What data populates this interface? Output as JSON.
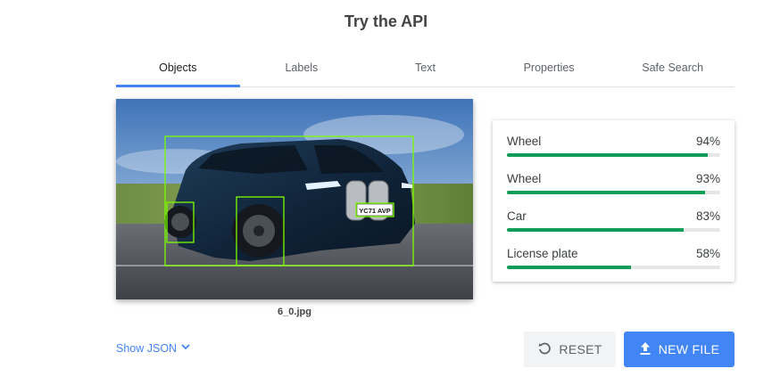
{
  "page": {
    "title": "Try the API"
  },
  "tabs": [
    {
      "label": "Objects",
      "active": true
    },
    {
      "label": "Labels",
      "active": false
    },
    {
      "label": "Text",
      "active": false
    },
    {
      "label": "Properties",
      "active": false
    },
    {
      "label": "Safe Search",
      "active": false
    }
  ],
  "image": {
    "file_name": "6_0.jpg",
    "plate_text": "YC71 AVP",
    "box_color": "#7cfc00"
  },
  "results": [
    {
      "label": "Wheel",
      "score": "94%",
      "value": 0.94
    },
    {
      "label": "Wheel",
      "score": "93%",
      "value": 0.93
    },
    {
      "label": "Car",
      "score": "83%",
      "value": 0.83
    },
    {
      "label": "License plate",
      "score": "58%",
      "value": 0.58
    }
  ],
  "footer": {
    "show_json_label": "Show JSON",
    "reset_label": "RESET",
    "new_file_label": "NEW FILE"
  },
  "colors": {
    "accent": "#4285f4",
    "bar": "#0f9d58",
    "bar_track": "#e6e6e6"
  },
  "icons": {
    "show_json": "chevron-down-icon",
    "reset": "reset-icon",
    "new_file": "upload-icon"
  }
}
